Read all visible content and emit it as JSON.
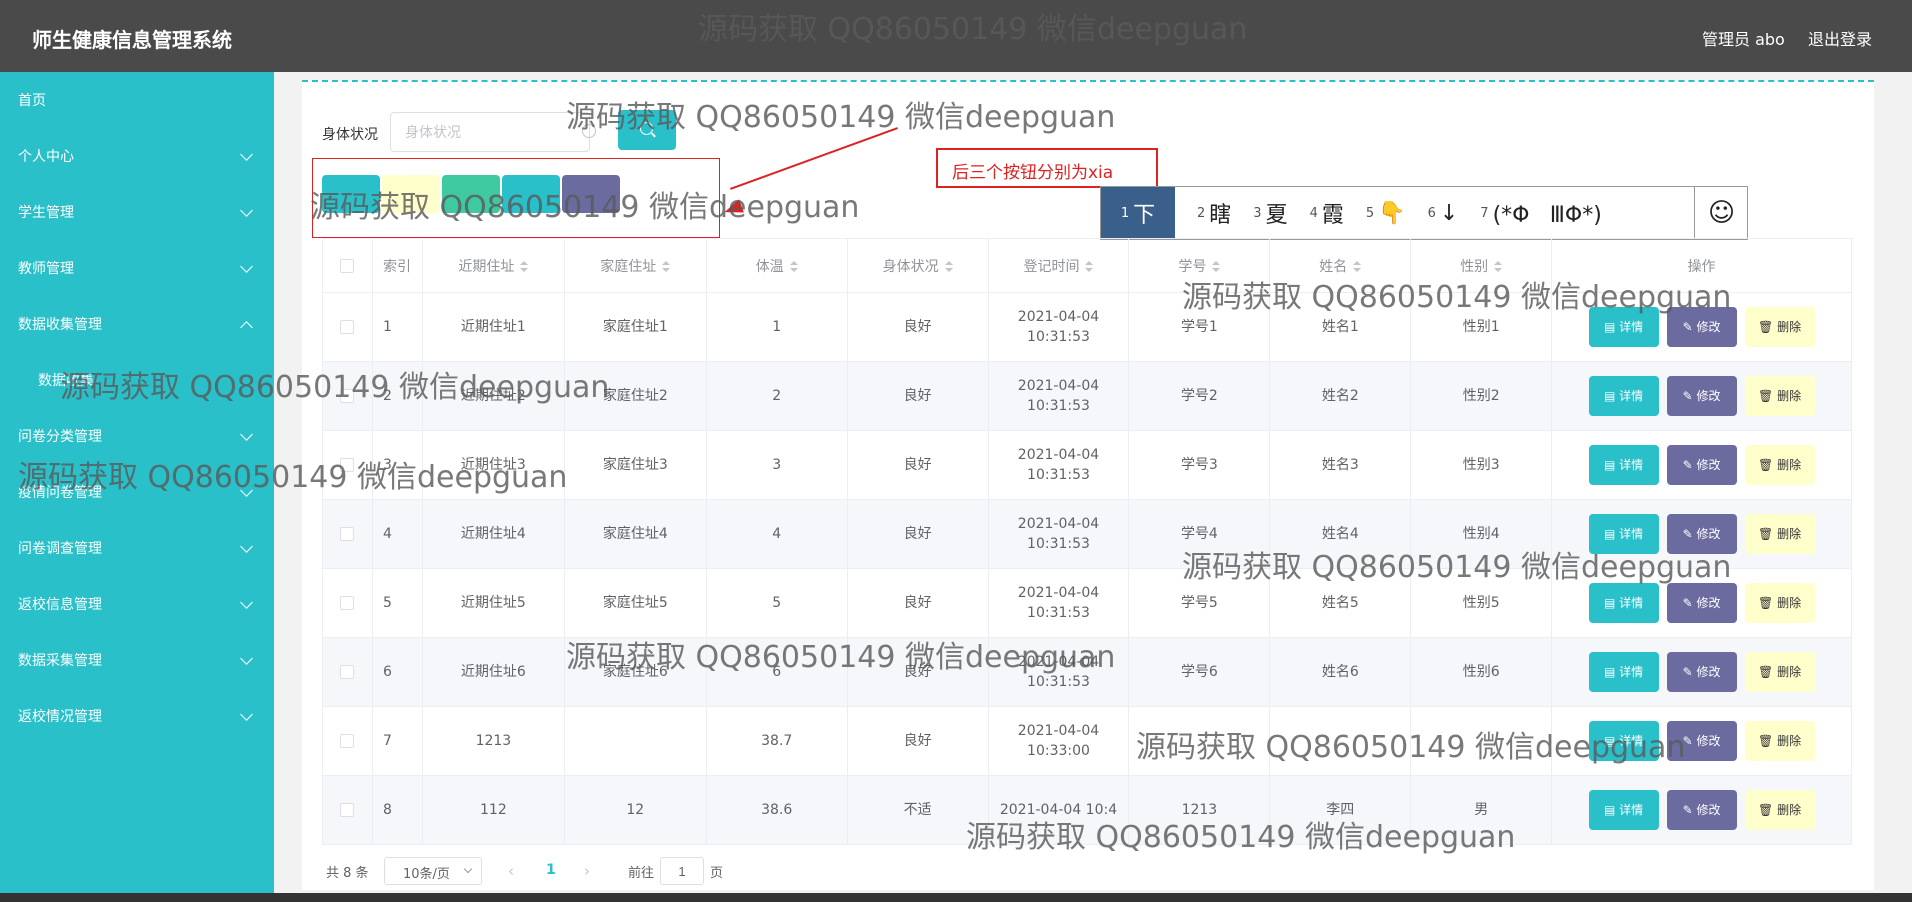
{
  "header": {
    "app_title": "师生健康信息管理系统",
    "user": "管理员 abo",
    "logout": "退出登录"
  },
  "sidebar": {
    "items": [
      {
        "label": "首页",
        "expanded": null
      },
      {
        "label": "个人中心",
        "expanded": false
      },
      {
        "label": "学生管理",
        "expanded": false
      },
      {
        "label": "教师管理",
        "expanded": false
      },
      {
        "label": "数据收集管理",
        "expanded": true
      },
      {
        "label": "数据收集",
        "expanded": null
      },
      {
        "label": "问卷分类管理",
        "expanded": false
      },
      {
        "label": "疫情问卷管理",
        "expanded": false
      },
      {
        "label": "问卷调查管理",
        "expanded": false
      },
      {
        "label": "返校信息管理",
        "expanded": false
      },
      {
        "label": "数据采集管理",
        "expanded": false
      },
      {
        "label": "返校情况管理",
        "expanded": false
      }
    ]
  },
  "search": {
    "label": "身体状况",
    "placeholder": "身体状况"
  },
  "annotation": "后三个按钮分别为xia",
  "ime": {
    "candidates": [
      {
        "n": "1",
        "text": "下"
      },
      {
        "n": "2",
        "text": "瞎"
      },
      {
        "n": "3",
        "text": "夏"
      },
      {
        "n": "4",
        "text": "霞"
      },
      {
        "n": "5",
        "text": "👇"
      },
      {
        "n": "6",
        "text": "↓"
      },
      {
        "n": "7",
        "text": "(*ΦㅤⅢΦ*)"
      }
    ],
    "emoji_button": "☺"
  },
  "table": {
    "headers": [
      "索引",
      "近期住址",
      "家庭住址",
      "体温",
      "身体状况",
      "登记时间",
      "学号",
      "姓名",
      "性别",
      "操作"
    ],
    "actions": {
      "detail": "详情",
      "edit": "修改",
      "delete": "删除"
    },
    "rows": [
      [
        "1",
        "近期住址1",
        "家庭住址1",
        "1",
        "良好",
        "2021-04-04 10:31:53",
        "学号1",
        "姓名1",
        "性别1"
      ],
      [
        "2",
        "近期住址2",
        "家庭住址2",
        "2",
        "良好",
        "2021-04-04 10:31:53",
        "学号2",
        "姓名2",
        "性别2"
      ],
      [
        "3",
        "近期住址3",
        "家庭住址3",
        "3",
        "良好",
        "2021-04-04 10:31:53",
        "学号3",
        "姓名3",
        "性别3"
      ],
      [
        "4",
        "近期住址4",
        "家庭住址4",
        "4",
        "良好",
        "2021-04-04 10:31:53",
        "学号4",
        "姓名4",
        "性别4"
      ],
      [
        "5",
        "近期住址5",
        "家庭住址5",
        "5",
        "良好",
        "2021-04-04 10:31:53",
        "学号5",
        "姓名5",
        "性别5"
      ],
      [
        "6",
        "近期住址6",
        "家庭住址6",
        "6",
        "良好",
        "2021-04-04 10:31:53",
        "学号6",
        "姓名6",
        "性别6"
      ],
      [
        "7",
        "1213",
        "",
        "38.7",
        "良好",
        "2021-04-04 10:33:00",
        "",
        "",
        ""
      ],
      [
        "8",
        "112",
        "12",
        "38.6",
        "不适",
        "2021-04-04 10:4",
        "1213",
        "李四",
        "男"
      ]
    ]
  },
  "pagination": {
    "total": "共 8 条",
    "page_size": "10条/页",
    "current": "1",
    "goto_prefix": "前往",
    "goto_value": "1",
    "goto_suffix": "页"
  },
  "watermark": "源码获取 QQ86050149 微信deepguan",
  "colors": {
    "sidebar": "#29c0ca",
    "header": "#4a4a4a",
    "detail_button": "#29c0ca",
    "edit_button": "#6b6b9f",
    "delete_button": "#ffffcc",
    "annotation": "#dd2222"
  }
}
